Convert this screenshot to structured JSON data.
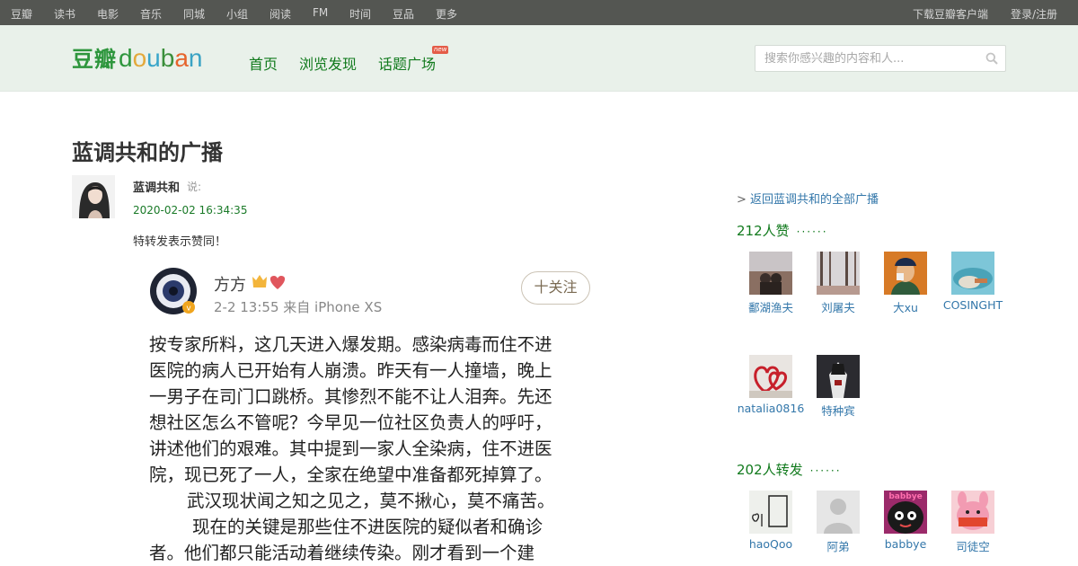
{
  "global_nav": {
    "left": [
      "豆瓣",
      "读书",
      "电影",
      "音乐",
      "同城",
      "小组",
      "阅读",
      "FM",
      "时间",
      "豆品",
      "更多"
    ],
    "download": "下载豆瓣客户端",
    "login": "登录/注册"
  },
  "header": {
    "logo_cn": "豆瓣",
    "logo_en": [
      "d",
      "o",
      "u",
      "b",
      "a",
      "n"
    ],
    "nav": [
      "首页",
      "浏览发现",
      "话题广场"
    ],
    "new_badge": "new",
    "search_placeholder": "搜索你感兴趣的内容和人...",
    "colors": {
      "bar": "#545652",
      "header_bg": "#e9f1ea",
      "link_green": "#117a1d"
    }
  },
  "main": {
    "page_title": "蓝调共和的广播",
    "author": "蓝调共和",
    "says": "说:",
    "timestamp": "2020-02-02 16:34:35",
    "status_text": "特转发表示赞同！",
    "repost": {
      "name": "方方",
      "meta": "2-2 13:55  来自 iPhone XS",
      "follow": "十关注",
      "lines": [
        "按专家所料，这几天进入爆发期。感染病毒而住不进",
        "医院的病人已开始有人崩溃。昨天有一人撞墙，晚上",
        "一男子在司门口跳桥。其惨烈不能不让人泪奔。先还",
        "想社区怎么不管呢？今早见一位社区负责人的呼吁，",
        "讲述他们的艰难。其中提到一家人全染病，住不进医",
        "院，现已死了一人，全家在绝望中准备都死掉算了。",
        "武汉现状闻之知之见之，莫不揪心，莫不痛苦。",
        "现在的关键是那些住不进医院的疑似者和确诊",
        "者。他们都只能活动着继续传染。刚才看到一个建"
      ]
    }
  },
  "sidebar": {
    "back_arrow": ">",
    "back_link": "返回蓝调共和的全部广播",
    "likes_title": "212人赞",
    "dots": "······",
    "likers": [
      "鄱湖渔夫",
      "刘屠夫",
      "大xu",
      "COSINGHT",
      "natalia0816",
      "特种宾"
    ],
    "reposts_title": "202人转发",
    "reposters": [
      "haoQoo",
      "阿弟",
      "babbye",
      "司徒空"
    ],
    "babbye_avatar_text": "babbye",
    "link_color": "#3377aa"
  }
}
